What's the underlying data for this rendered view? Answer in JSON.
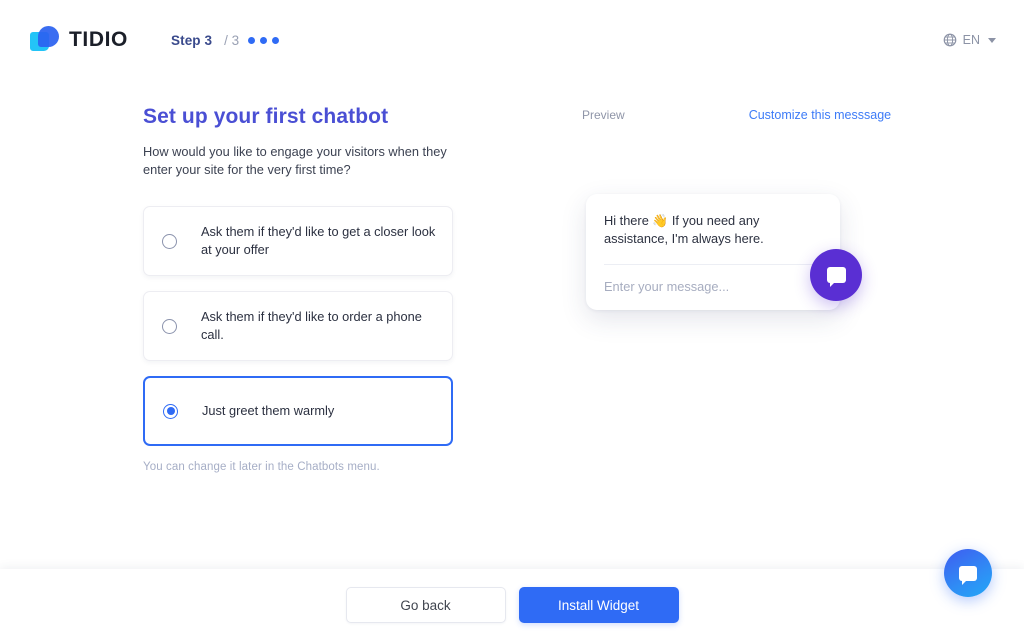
{
  "header": {
    "logo_text": "TIDIO",
    "logo_icon": "tidio-logo-icon",
    "step_label": "Step 3",
    "step_total": "/ 3",
    "dots_count": 3,
    "language": {
      "icon": "globe-icon",
      "value": "EN",
      "caret_icon": "chevron-down-icon"
    }
  },
  "main": {
    "title": "Set up your first chatbot",
    "subtitle": "How would you like to engage your visitors when they enter your site for the very first time?",
    "options": [
      {
        "label": "Ask them if they'd like to get a closer look at your offer",
        "selected": false
      },
      {
        "label": "Ask them if they'd like to order a phone call.",
        "selected": false
      },
      {
        "label": "Just greet them warmly",
        "selected": true
      }
    ],
    "note": "You can change it later in the Chatbots menu."
  },
  "preview": {
    "label": "Preview",
    "customize_link": "Customize this messsage",
    "chat_message": "Hi there 👋 If you need any assistance, I'm always here.",
    "input_placeholder": "Enter your message...",
    "fab_icon": "chat-bubble-icon"
  },
  "footer": {
    "back_label": "Go back",
    "install_label": "Install Widget"
  },
  "global_widget": {
    "icon": "chat-bubble-icon"
  },
  "colors": {
    "accent_blue": "#2f6bf5",
    "heading_purple": "#4a4fd4",
    "link_blue": "#3d7bf7",
    "preview_fab_purple": "#5a2fd3",
    "muted_text": "#a6aec6"
  }
}
